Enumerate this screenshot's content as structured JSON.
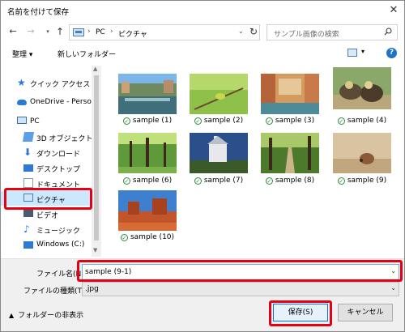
{
  "window": {
    "title": "名前を付けて保存",
    "close_icon": "close-icon"
  },
  "nav": {
    "address_parts": [
      "PC",
      "ピクチャ"
    ],
    "search_placeholder": "サンプル画像の検索"
  },
  "toolbar": {
    "organize_label": "整理 ▾",
    "new_folder_label": "新しいフォルダー"
  },
  "sidebar": {
    "items": [
      {
        "label": "クイック アクセス",
        "icon": "star-icon"
      },
      {
        "label": "OneDrive - Person",
        "icon": "cloud-icon"
      },
      {
        "label": "PC",
        "icon": "computer-icon"
      },
      {
        "label": "3D オブジェクト",
        "icon": "3d-objects-icon"
      },
      {
        "label": "ダウンロード",
        "icon": "download-icon"
      },
      {
        "label": "デスクトップ",
        "icon": "desktop-icon"
      },
      {
        "label": "ドキュメント",
        "icon": "documents-icon"
      },
      {
        "label": "ピクチャ",
        "icon": "pictures-icon"
      },
      {
        "label": "ビデオ",
        "icon": "videos-icon"
      },
      {
        "label": "ミュージック",
        "icon": "music-icon"
      },
      {
        "label": "Windows (C:)",
        "icon": "drive-icon"
      }
    ]
  },
  "files": [
    {
      "name": "sample (1)",
      "scene": "canal-city"
    },
    {
      "name": "sample (2)",
      "scene": "green-bird"
    },
    {
      "name": "sample (3)",
      "scene": "venice-canal"
    },
    {
      "name": "sample (4)",
      "scene": "ducklings"
    },
    {
      "name": "sample (6)",
      "scene": "forest-trees"
    },
    {
      "name": "sample (7)",
      "scene": "castle"
    },
    {
      "name": "sample (8)",
      "scene": "forest-path"
    },
    {
      "name": "sample (9)",
      "scene": "hermit-crab"
    },
    {
      "name": "sample (10)",
      "scene": "desert-mesa"
    }
  ],
  "bottom": {
    "filename_label": "ファイル名(N):",
    "filename_value": "sample (9-1)",
    "filetype_label": "ファイルの種類(T):",
    "filetype_value": ".jpg",
    "hide_folders_label": "フォルダーの非表示",
    "save_label": "保存(S)",
    "cancel_label": "キャンセル"
  },
  "colors": {
    "highlight": "#e60012",
    "selection": "#cce8ff",
    "accent": "#0078d7"
  }
}
